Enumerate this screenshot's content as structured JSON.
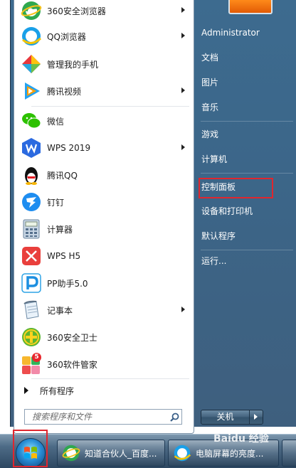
{
  "programs": [
    {
      "label": "360安全浏览器",
      "icon": "360-browser-icon",
      "submenu": true
    },
    {
      "label": "QQ浏览器",
      "icon": "qq-browser-icon",
      "submenu": true
    },
    {
      "label": "管理我的手机",
      "icon": "phone-manager-icon",
      "submenu": false
    },
    {
      "label": "腾讯视频",
      "icon": "tencent-video-icon",
      "submenu": true
    },
    {
      "label": "微信",
      "icon": "wechat-icon",
      "submenu": false
    },
    {
      "label": "WPS 2019",
      "icon": "wps-icon",
      "submenu": true
    },
    {
      "label": "腾讯QQ",
      "icon": "qq-penguin-icon",
      "submenu": false
    },
    {
      "label": "钉钉",
      "icon": "dingtalk-icon",
      "submenu": false
    },
    {
      "label": "计算器",
      "icon": "calculator-icon",
      "submenu": false
    },
    {
      "label": "WPS H5",
      "icon": "wps-h5-icon",
      "submenu": false
    },
    {
      "label": "PP助手5.0",
      "icon": "pp-assistant-icon",
      "submenu": false
    },
    {
      "label": "记事本",
      "icon": "notepad-icon",
      "submenu": true
    },
    {
      "label": "360安全卫士",
      "icon": "360-safe-icon",
      "submenu": false
    },
    {
      "label": "360软件管家",
      "icon": "360-software-manager-icon",
      "submenu": false,
      "badge": "5"
    }
  ],
  "all_programs": "所有程序",
  "search": {
    "placeholder": "搜索程序和文件"
  },
  "right_pane": {
    "items": [
      {
        "label": "Administrator"
      },
      {
        "label": "文档"
      },
      {
        "label": "图片"
      },
      {
        "label": "音乐"
      },
      {
        "label": "游戏"
      },
      {
        "label": "计算机"
      },
      {
        "label": "控制面板"
      },
      {
        "label": "设备和打印机"
      },
      {
        "label": "默认程序"
      },
      {
        "label": "运行..."
      }
    ]
  },
  "shutdown": {
    "label": "关机"
  },
  "taskbar": {
    "items": [
      {
        "label": "知道合伙人_百度...",
        "icon": "360-browser-icon"
      },
      {
        "label": "电脑屏幕的亮度...",
        "icon": "qq-browser-icon"
      }
    ]
  },
  "watermark": "Baidu 经验",
  "colors": {
    "highlight": "#e0262e",
    "menu_glass": "#3d6b8f"
  }
}
